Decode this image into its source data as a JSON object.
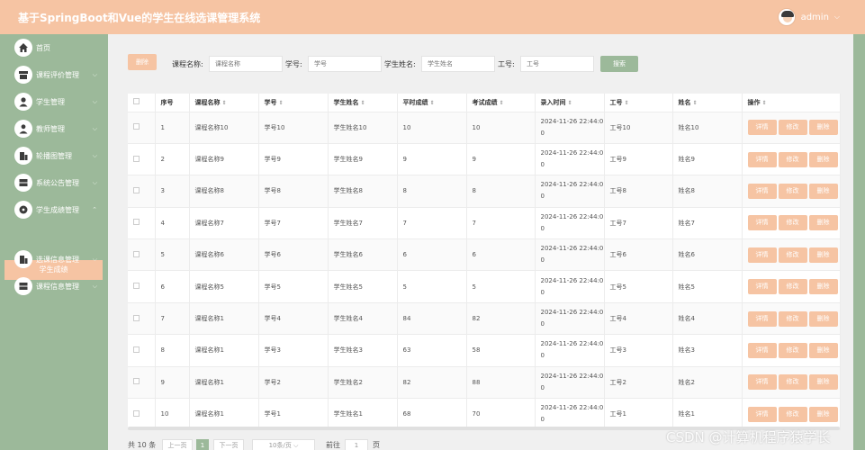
{
  "header": {
    "title": "基于SpringBoot和Vue的学生在线选课管理系统",
    "username": "admin"
  },
  "sidebar": {
    "items": [
      {
        "label": "首页",
        "icon": "home-icon"
      },
      {
        "label": "课程评价管理",
        "icon": "card-icon"
      },
      {
        "label": "学生管理",
        "icon": "user-icon"
      },
      {
        "label": "教师管理",
        "icon": "teacher-icon"
      },
      {
        "label": "轮播图管理",
        "icon": "building-icon"
      },
      {
        "label": "系统公告管理",
        "icon": "server-icon"
      },
      {
        "label": "学生成绩管理",
        "icon": "disc-icon"
      },
      {
        "label": "选课信息管理",
        "icon": "building-icon"
      },
      {
        "label": "课程信息管理",
        "icon": "server-icon"
      }
    ],
    "submenu_active": "学生成绩"
  },
  "search": {
    "delete_label": "删除",
    "course_name_label": "课程名称:",
    "course_name_placeholder": "课程名称",
    "student_no_label": "学号:",
    "student_no_placeholder": "学号",
    "student_name_label": "学生姓名:",
    "student_name_placeholder": "学生姓名",
    "work_no_label": "工号:",
    "work_no_placeholder": "工号",
    "search_label": "搜索"
  },
  "table": {
    "headers": [
      "序号",
      "课程名称",
      "学号",
      "学生姓名",
      "平时成绩",
      "考试成绩",
      "录入时间",
      "工号",
      "姓名",
      "操作"
    ],
    "actions": {
      "detail": "详情",
      "edit": "修改",
      "delete": "删除"
    },
    "rows": [
      {
        "idx": "1",
        "course": "课程名称10",
        "sno": "学号10",
        "sname": "学生姓名10",
        "usual": "10",
        "exam": "10",
        "time": "2024-11-26 22:44:00",
        "wno": "工号10",
        "tname": "姓名10"
      },
      {
        "idx": "2",
        "course": "课程名称9",
        "sno": "学号9",
        "sname": "学生姓名9",
        "usual": "9",
        "exam": "9",
        "time": "2024-11-26 22:44:00",
        "wno": "工号9",
        "tname": "姓名9"
      },
      {
        "idx": "3",
        "course": "课程名称8",
        "sno": "学号8",
        "sname": "学生姓名8",
        "usual": "8",
        "exam": "8",
        "time": "2024-11-26 22:44:00",
        "wno": "工号8",
        "tname": "姓名8"
      },
      {
        "idx": "4",
        "course": "课程名称7",
        "sno": "学号7",
        "sname": "学生姓名7",
        "usual": "7",
        "exam": "7",
        "time": "2024-11-26 22:44:00",
        "wno": "工号7",
        "tname": "姓名7"
      },
      {
        "idx": "5",
        "course": "课程名称6",
        "sno": "学号6",
        "sname": "学生姓名6",
        "usual": "6",
        "exam": "6",
        "time": "2024-11-26 22:44:00",
        "wno": "工号6",
        "tname": "姓名6"
      },
      {
        "idx": "6",
        "course": "课程名称5",
        "sno": "学号5",
        "sname": "学生姓名5",
        "usual": "5",
        "exam": "5",
        "time": "2024-11-26 22:44:00",
        "wno": "工号5",
        "tname": "姓名5"
      },
      {
        "idx": "7",
        "course": "课程名称1",
        "sno": "学号4",
        "sname": "学生姓名4",
        "usual": "84",
        "exam": "82",
        "time": "2024-11-26 22:44:00",
        "wno": "工号4",
        "tname": "姓名4"
      },
      {
        "idx": "8",
        "course": "课程名称1",
        "sno": "学号3",
        "sname": "学生姓名3",
        "usual": "63",
        "exam": "58",
        "time": "2024-11-26 22:44:00",
        "wno": "工号3",
        "tname": "姓名3"
      },
      {
        "idx": "9",
        "course": "课程名称1",
        "sno": "学号2",
        "sname": "学生姓名2",
        "usual": "82",
        "exam": "88",
        "time": "2024-11-26 22:44:00",
        "wno": "工号2",
        "tname": "姓名2"
      },
      {
        "idx": "10",
        "course": "课程名称1",
        "sno": "学号1",
        "sname": "学生姓名1",
        "usual": "68",
        "exam": "70",
        "time": "2024-11-26 22:44:00",
        "wno": "工号1",
        "tname": "姓名1"
      }
    ]
  },
  "pagination": {
    "total_text": "共 10 条",
    "prev_label": "上一页",
    "current_page": "1",
    "next_label": "下一页",
    "page_size_label": "10条/页",
    "goto_label": "前往",
    "goto_value": "1",
    "page_unit": "页"
  },
  "watermark": "CSDN @计算机程序猿学长",
  "colors": {
    "header": "#f6c4a3",
    "sidebar": "#9cb99a",
    "button": "#f6c4a3"
  }
}
